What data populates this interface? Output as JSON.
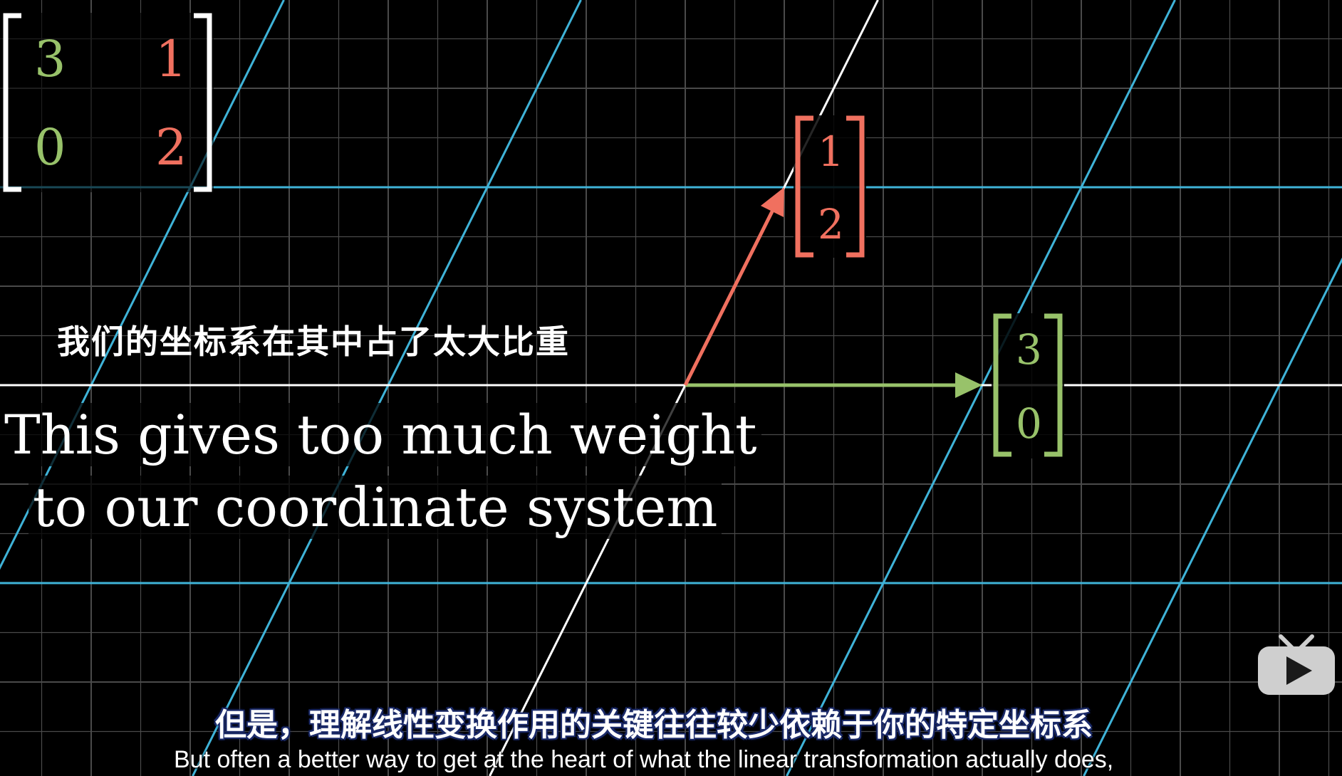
{
  "matrix": {
    "a11": "3",
    "a12": "1",
    "a21": "0",
    "a22": "2",
    "col1_color": "#98c26a",
    "col2_color": "#f0705f"
  },
  "vector_j": {
    "top": "1",
    "bottom": "2",
    "color": "#f0705f"
  },
  "vector_i": {
    "top": "3",
    "bottom": "0",
    "color": "#98c26a"
  },
  "captions": {
    "cn_top": "我们的坐标系在其中占了太大比重",
    "en_line1": "This gives too much weight",
    "en_line2": "to our coordinate system"
  },
  "subtitles": {
    "cn": "但是，理解线性变换作用的关键往往较少依赖于你的特定坐标系",
    "en": "But often a better way to get at the heart of what the linear transformation actually does,"
  },
  "colors": {
    "background": "#000000",
    "grid": "#4a4a4a",
    "transformed_grid": "#3fb3d8",
    "axis": "#ffffff"
  },
  "icons": {
    "player_logo": "tv-play-icon"
  }
}
